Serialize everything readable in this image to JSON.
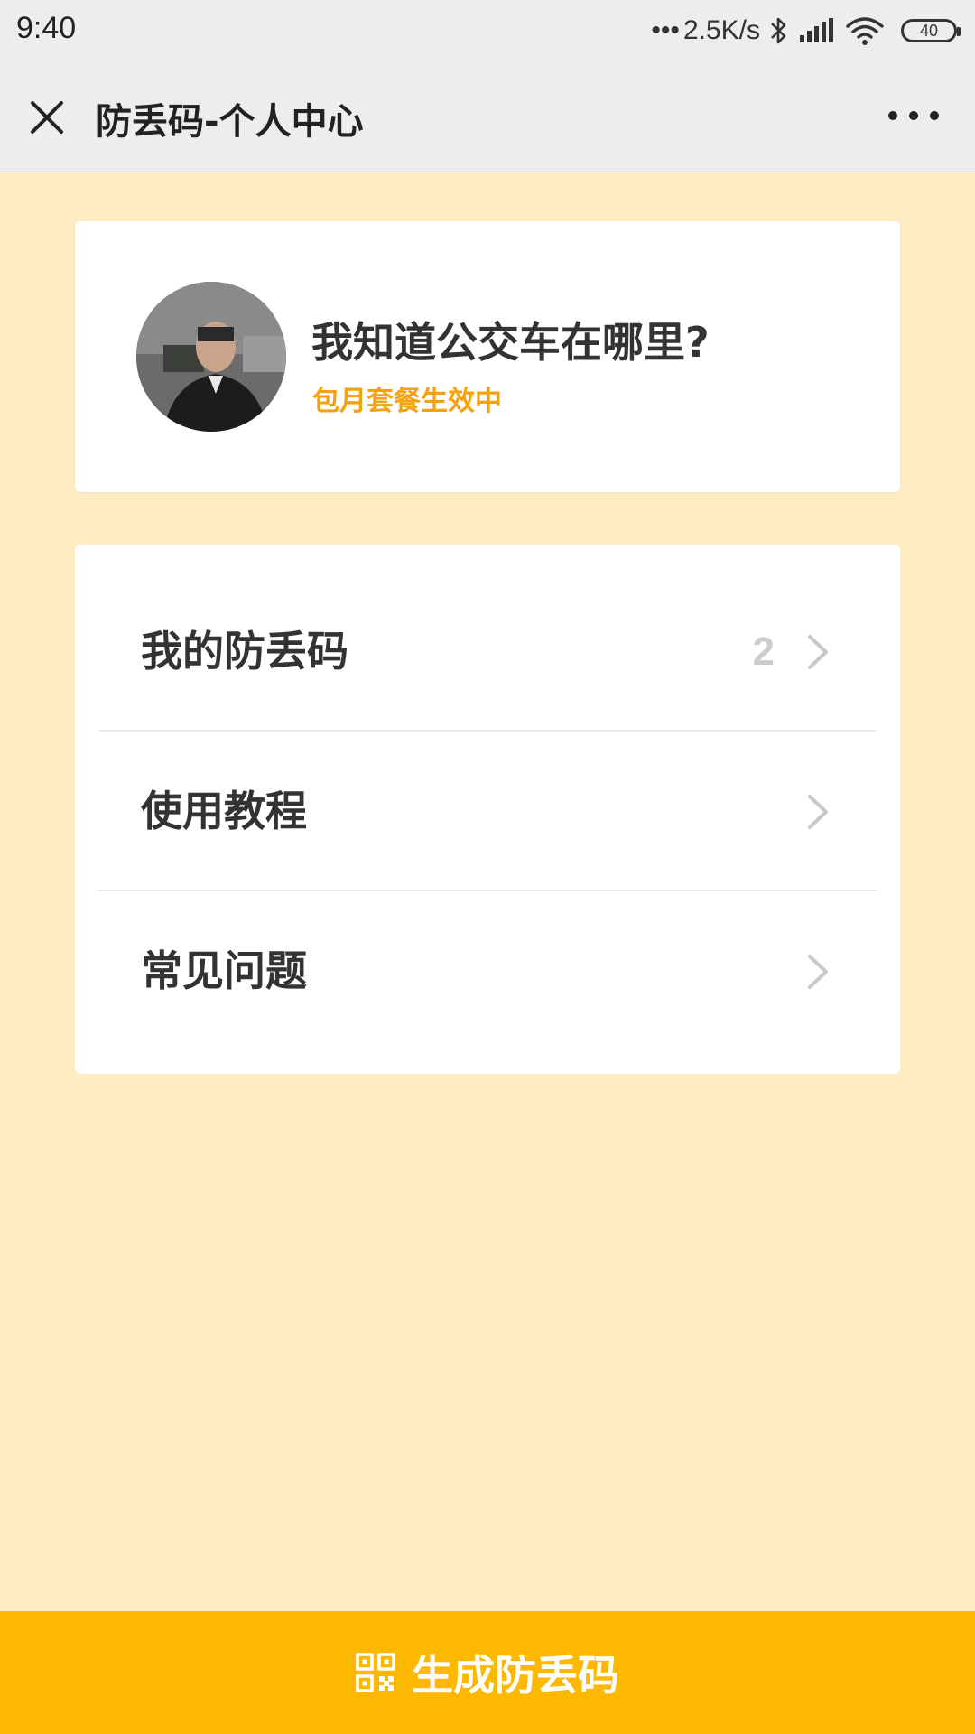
{
  "status_bar": {
    "time": "9:40",
    "dots": "•••",
    "net_speed": "2.5K/s",
    "battery": "40",
    "icons": [
      "bluetooth-icon",
      "signal-icon",
      "wifi-icon",
      "battery-icon"
    ]
  },
  "nav": {
    "title": "防丢码-个人中心",
    "close_icon": "close-icon",
    "more_icon": "more-icon"
  },
  "profile": {
    "name": "我知道公交车在哪里?",
    "status": "包月套餐生效中",
    "status_color": "#F4A20F"
  },
  "menu": {
    "items": [
      {
        "label": "我的防丢码",
        "count": "2"
      },
      {
        "label": "使用教程",
        "count": ""
      },
      {
        "label": "常见问题",
        "count": ""
      }
    ]
  },
  "footer": {
    "button_label": "生成防丢码",
    "button_color": "#FDB803",
    "icon": "qr-code-icon"
  },
  "colors": {
    "background": "#FDEBC2",
    "accent": "#FDB803"
  }
}
